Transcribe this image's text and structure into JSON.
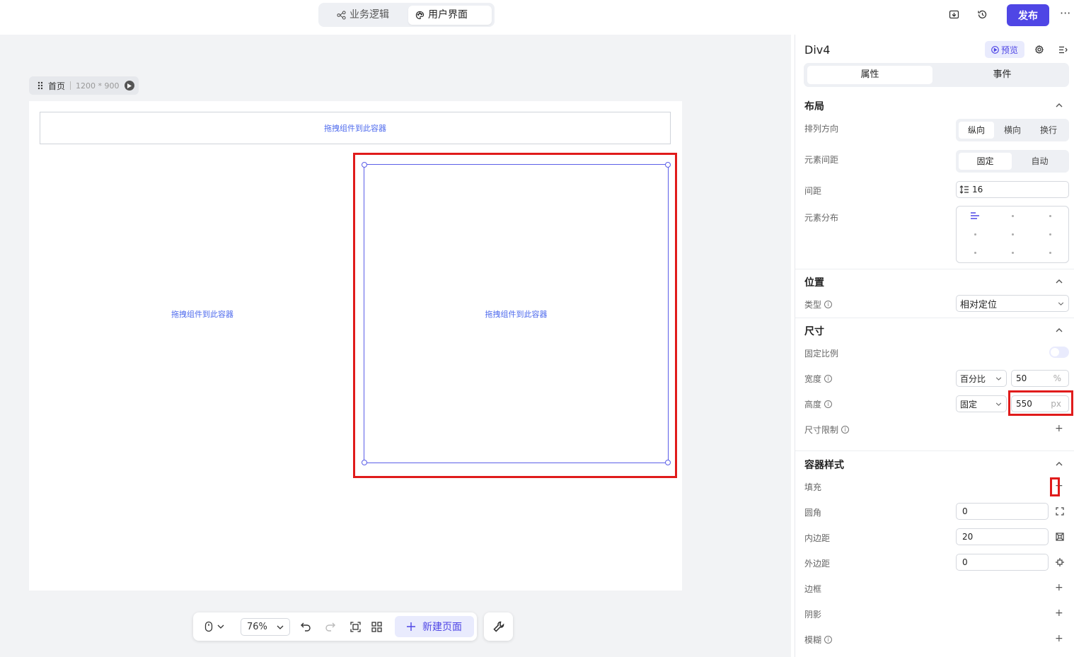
{
  "topbar": {
    "tab_logic": "业务逻辑",
    "tab_ui": "用户界面",
    "publish_label": "发布",
    "more_label": "···"
  },
  "canvas": {
    "page_name": "首页",
    "page_size": "1200 * 900",
    "drop_hint_top": "拖拽组件到此容器",
    "drop_hint_left": "拖拽组件到此容器",
    "drop_hint_selected": "拖拽组件到此容器"
  },
  "toolbar": {
    "zoom": "76%",
    "new_page_label": "新建页面"
  },
  "panel": {
    "title": "Div4",
    "preview_label": "预览",
    "tab_props": "属性",
    "tab_events": "事件",
    "layout": {
      "title": "布局",
      "direction_label": "排列方向",
      "direction_options": [
        "纵向",
        "横向",
        "换行"
      ],
      "direction_selected": "纵向",
      "spacing_mode_label": "元素间距",
      "spacing_mode_options": [
        "固定",
        "自动"
      ],
      "spacing_mode_selected": "固定",
      "gap_label": "间距",
      "gap_value": "16",
      "distribution_label": "元素分布"
    },
    "position": {
      "title": "位置",
      "type_label": "类型",
      "type_value": "相对定位"
    },
    "size": {
      "title": "尺寸",
      "aspect_label": "固定比例",
      "aspect_on": false,
      "width_label": "宽度",
      "width_mode": "百分比",
      "width_value": "50",
      "width_unit": "%",
      "height_label": "高度",
      "height_mode": "固定",
      "height_value": "550",
      "height_unit": "px",
      "limit_label": "尺寸限制"
    },
    "container_style": {
      "title": "容器样式",
      "fill_label": "填充",
      "radius_label": "圆角",
      "radius_value": "0",
      "padding_label": "内边距",
      "padding_value": "20",
      "margin_label": "外边距",
      "margin_value": "0",
      "border_label": "边框",
      "shadow_label": "阴影",
      "blur_label": "模糊"
    }
  },
  "colors": {
    "accent": "#4f46e5",
    "selection_blue": "#5b5fe8",
    "highlight_red": "#e01b1b"
  }
}
